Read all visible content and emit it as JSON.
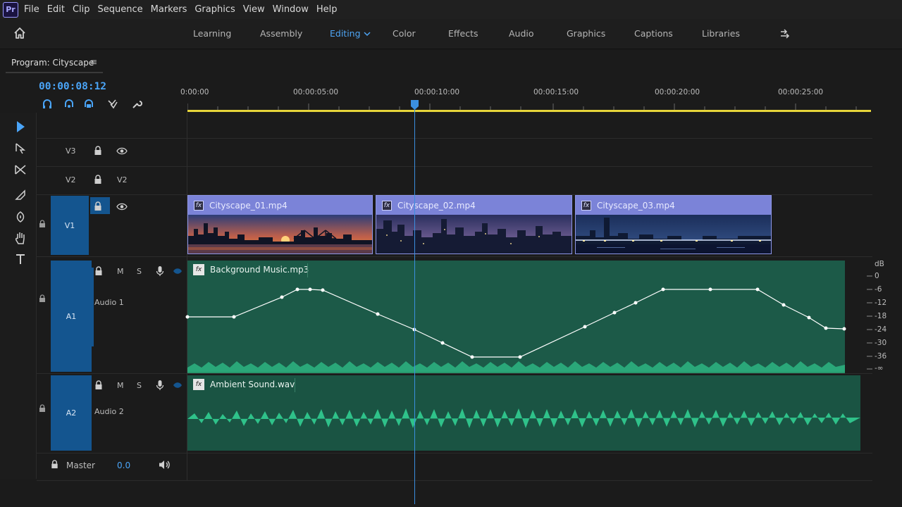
{
  "app": {
    "logo": "Pr"
  },
  "menubar": {
    "items": [
      "File",
      "Edit",
      "Clip",
      "Sequence",
      "Markers",
      "Graphics",
      "View",
      "Window",
      "Help"
    ]
  },
  "workspaces": {
    "tabs": [
      "Learning",
      "Assembly",
      "Editing",
      "Color",
      "Effects",
      "Audio",
      "Graphics",
      "Captions",
      "Libraries"
    ],
    "active": "Editing"
  },
  "panel": {
    "title": "Program: Cityscape",
    "menu_glyph": "≡"
  },
  "timeline": {
    "timecode": "00:00:08:12",
    "ruler": [
      "0:00:00",
      "00:00:05:00",
      "00:00:10:00",
      "00:00:15:00",
      "00:00:20:00",
      "00:00:25:00"
    ]
  },
  "tracks": {
    "v3": {
      "name": "V3"
    },
    "v2": {
      "name": "V2",
      "target": "V2"
    },
    "v1": {
      "name": "V1"
    },
    "a1": {
      "name": "A1",
      "label": "Audio 1",
      "mute": "M",
      "solo": "S"
    },
    "a2": {
      "name": "A2",
      "label": "Audio 2",
      "mute": "M",
      "solo": "S"
    },
    "master": {
      "name": "Master",
      "value": "0.0"
    }
  },
  "clips": {
    "video": [
      {
        "name": "Cityscape_01.mp4",
        "fx": "fx"
      },
      {
        "name": "Cityscape_02.mp4",
        "fx": "fx"
      },
      {
        "name": "Cityscape_03.mp4",
        "fx": "fx"
      }
    ],
    "audio": [
      {
        "name": "Background Music.mp3",
        "fx": "fx"
      },
      {
        "name": "Ambient Sound.wav",
        "fx": "fx"
      }
    ]
  },
  "db_scale": [
    "dB",
    "0",
    "-6",
    "-12",
    "-18",
    "-24",
    "-30",
    "-36",
    "-∞"
  ],
  "colors": {
    "accent": "#4aa4f7",
    "playhead": "#3b8fe0",
    "work_area": "#e6d53a",
    "video_clip": "#7b83d8",
    "audio_clip": "#1c5a48",
    "waveform": "#2fc28a"
  }
}
